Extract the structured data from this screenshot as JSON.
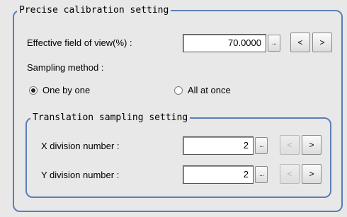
{
  "calibration": {
    "group_title": "Precise calibration setting",
    "fov": {
      "label": "Effective field of view(%) :",
      "value": "70.0000",
      "ellipsis": "...",
      "dec": "<",
      "inc": ">"
    },
    "sampling": {
      "label": "Sampling method :",
      "options": [
        {
          "label": "One by one",
          "selected": true
        },
        {
          "label": "All at once",
          "selected": false
        }
      ]
    },
    "translation": {
      "group_title": "Translation sampling setting",
      "x_div": {
        "label": "X division number :",
        "value": "2",
        "ellipsis": "...",
        "dec": "<",
        "inc": ">",
        "dec_enabled": false
      },
      "y_div": {
        "label": "Y division number :",
        "value": "2",
        "ellipsis": "...",
        "dec": "<",
        "inc": ">",
        "dec_enabled": false
      }
    }
  }
}
